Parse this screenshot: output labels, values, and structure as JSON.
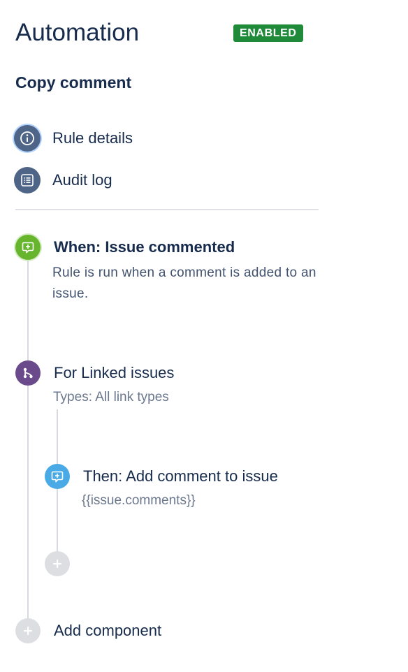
{
  "header": {
    "title": "Automation",
    "status_badge": "ENABLED",
    "rule_name": "Copy comment"
  },
  "nav": {
    "items": [
      {
        "label": "Rule details",
        "icon": "info-icon"
      },
      {
        "label": "Audit log",
        "icon": "list-icon"
      }
    ]
  },
  "steps": {
    "trigger": {
      "title": "When: Issue commented",
      "description": "Rule is run when a comment is added to an issue.",
      "icon": "comment-plus-icon"
    },
    "branch": {
      "title": "For Linked issues",
      "subtitle": "Types: All link types",
      "icon": "branch-icon"
    },
    "action": {
      "title": "Then: Add comment to issue",
      "subtitle": "{{issue.comments}}",
      "icon": "comment-plus-icon"
    },
    "add_component_label": "Add component"
  },
  "colors": {
    "title": "#172b4d",
    "badge": "#1f8a3a",
    "nav_icon": "#4f6587",
    "trigger": "#66b52c",
    "branch": "#6b4a8c",
    "action": "#4aaae6",
    "add_circle": "#dcdee2",
    "connector": "#d7dbe0"
  }
}
